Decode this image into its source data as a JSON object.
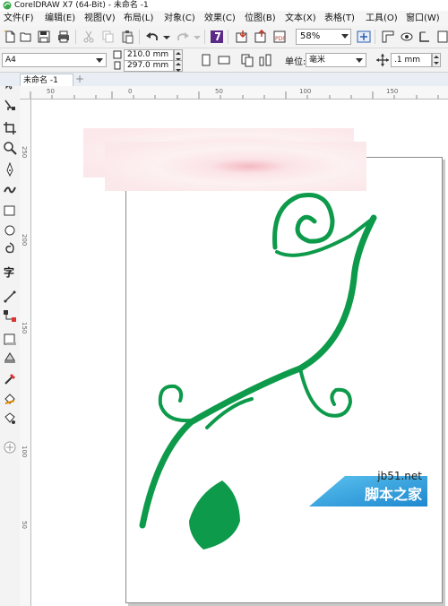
{
  "window": {
    "title": "CorelDRAW X7 (64-Bit) - 未命名 -1"
  },
  "menu": [
    "文件(F)",
    "编辑(E)",
    "视图(V)",
    "布局(L)",
    "对象(C)",
    "效果(C)",
    "位图(B)",
    "文本(X)",
    "表格(T)",
    "工具(O)",
    "窗口(W)"
  ],
  "toolbar": {
    "zoom": "58%"
  },
  "propbar": {
    "paper_size": "A4",
    "width": "210.0 mm",
    "height": "297.0 mm",
    "units_label": "单位:",
    "units": "毫米",
    "nudge": ".1 mm"
  },
  "doc_tab": {
    "label": "未命名 -1"
  },
  "ruler": {
    "h_labels": [
      "50",
      "0",
      "50",
      "100",
      "150"
    ],
    "v_labels": [
      "250",
      "200",
      "150",
      "100",
      "50"
    ]
  },
  "art": {
    "vine_color": "#0d9a4a"
  },
  "watermark": {
    "site": "jb51.net",
    "name": "脚本之家"
  }
}
